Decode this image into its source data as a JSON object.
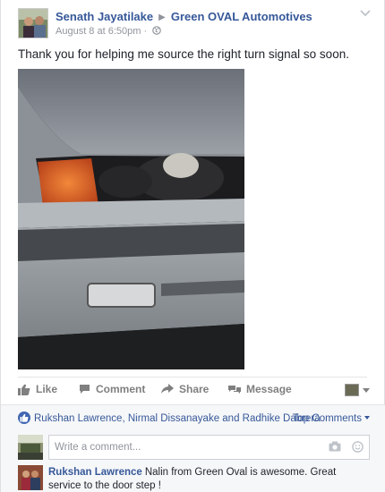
{
  "post": {
    "author": "Senath Jayatilake",
    "target": "Green OVAL Automotives",
    "timestamp": "August 8 at 6:50pm",
    "privacy_icon": "globe-icon",
    "text": "Thank you for helping me source the right turn signal so soon."
  },
  "actions": {
    "like": "Like",
    "comment": "Comment",
    "share": "Share",
    "message": "Message"
  },
  "likes_summary": "Rukshan Lawrence, Nirmal Dissanayake and Radhike Dabrera",
  "top_comments_label": "Top Comments",
  "comment_box": {
    "placeholder": "Write a comment..."
  },
  "comments": [
    {
      "author": "Rukshan Lawrence",
      "text": "Nalin from Green Oval is awesome. Great service to the door step !"
    }
  ],
  "colors": {
    "link": "#365899",
    "muted": "#90949c",
    "action": "#7f7f7f",
    "like_badge": "#4267b2"
  }
}
